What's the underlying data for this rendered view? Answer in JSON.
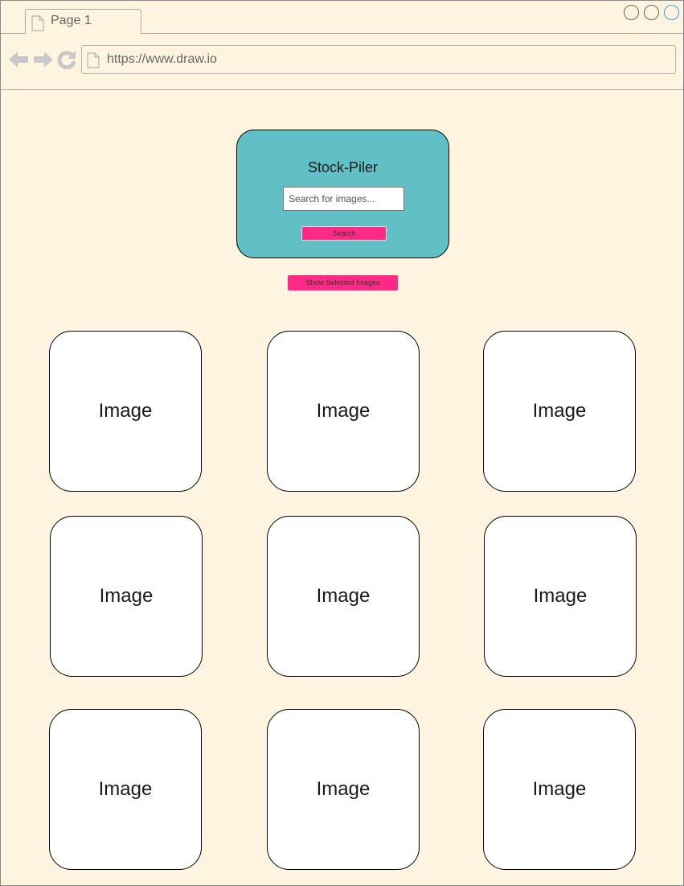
{
  "browser": {
    "tab_label": "Page 1",
    "url": "https://www.draw.io",
    "icons": [
      "back-arrow-icon",
      "forward-arrow-icon",
      "reload-icon",
      "document-icon"
    ]
  },
  "app": {
    "title": "Stock-Piler",
    "search_placeholder": "Search for images...",
    "search_button": "Search",
    "show_selected_button": "Show Selected Images"
  },
  "gallery": [
    {
      "label": "Image"
    },
    {
      "label": "Image"
    },
    {
      "label": "Image"
    },
    {
      "label": "Image"
    },
    {
      "label": "Image"
    },
    {
      "label": "Image"
    },
    {
      "label": "Image"
    },
    {
      "label": "Image"
    },
    {
      "label": "Image"
    }
  ],
  "colors": {
    "page_background": "#fff4e0",
    "card_teal": "#61c0c6",
    "button_pink": "#ff2a85"
  }
}
